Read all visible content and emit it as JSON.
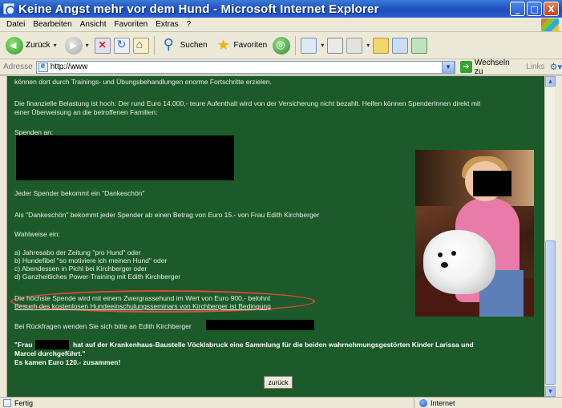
{
  "window": {
    "title": "Keine Angst mehr vor dem Hund - Microsoft Internet Explorer",
    "minimize": "_",
    "maximize": "□",
    "close": "X"
  },
  "menubar": {
    "items": [
      "Datei",
      "Bearbeiten",
      "Ansicht",
      "Favoriten",
      "Extras",
      "?"
    ]
  },
  "toolbar": {
    "back_label": "Zurück",
    "search_label": "Suchen",
    "favorites_label": "Favoriten"
  },
  "addressbar": {
    "label": "Adresse",
    "url": "http://www",
    "go_label": "Wechseln zu",
    "links_label": "Links"
  },
  "content": {
    "line1": "können dort durch Trainings- und Übungsbehandlungen enorme Fortschritte erzielen.",
    "line2a": "Die finanzielle Belastung ist hoch:  Der rund Euro 14.000,- teure Aufenthalt wird von der Versicherung nicht bezahlt. Helfen können SpenderInnen direkt mit",
    "line2b": "einer Überweisung an die betroffenen Familien:",
    "spenden": "Spenden an:",
    "danke1": "Jeder Spender bekommt ein \"Dankeschön\"",
    "danke2": "Als  \"Dankeschön\" bekommt jeder Spender ab einen Betrag von Euro 15.- von Frau Edith Kirchberger",
    "wahlweise": "Wahlweise ein:",
    "option_a": "a) Jahresabo der Zeitung \"pro Hund\" oder",
    "option_b": "b) Hundefibel \"so motiviere ich meinen Hund\" oder",
    "option_c": "c)  Abendessen in Pichl bei Kirchberger oder",
    "option_d": "d) Ganzheitliches Power-Training mit Edith Kirchberger",
    "hoechste": "Die höchste Spende wird mit einem Zwergrassehund im Wert von Euro 900,- belohnt",
    "besuch": "Besuch des kostenlosen Hundeeinschulungsseminars von Kirchberger ist Bedingung",
    "rueckfragen": "Bei Rückfragen wenden Sie sich bitte an Edith Kirchberger",
    "frau_start": "\"Frau",
    "frau_rest": "hat auf der Krankenhaus-Baustelle Vöcklabruck eine Sammlung für die beiden wahrnehmungsgestörten Kinder Larissa und",
    "marcel": "Marcel durchgeführt.\"",
    "ergebnis": "Es kamen Euro 120.- zusammen!",
    "back_button": "zurück"
  },
  "status": {
    "left": "Fertig",
    "zone": "Internet"
  },
  "colors": {
    "page_background": "#1c5a2a",
    "highlight_ellipse": "#e04a3a",
    "titlebar": "#2558c8"
  }
}
